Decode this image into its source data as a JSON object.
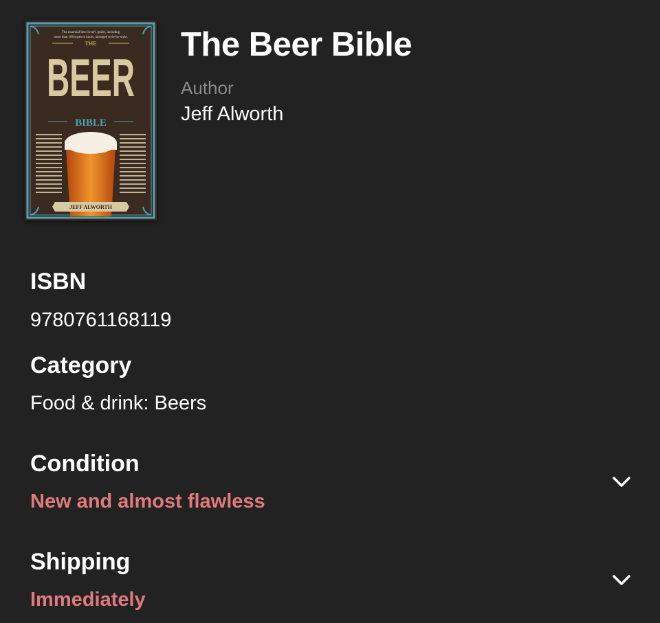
{
  "book": {
    "title": "The Beer Bible",
    "author_label": "Author",
    "author_name": "Jeff Alworth",
    "cover": {
      "tagline_line1": "The essential beer lover's guide, including",
      "tagline_line2": "more than 100 types to know, arranged style-by-style.",
      "the": "THE",
      "beer": "BEER",
      "bible": "BIBLE",
      "author": "JEFF ALWORTH",
      "background_color": "#3a2a1f",
      "border_color": "#4ba3b7",
      "title_color": "#d9c9a0"
    }
  },
  "fields": {
    "isbn": {
      "label": "ISBN",
      "value": "9780761168119"
    },
    "category": {
      "label": "Category",
      "value": "Food & drink: Beers"
    },
    "condition": {
      "label": "Condition",
      "value": "New and almost flawless",
      "icon": "chevron-down-icon"
    },
    "shipping": {
      "label": "Shipping",
      "value": "Immediately",
      "icon": "chevron-down-icon"
    }
  },
  "colors": {
    "background": "#222222",
    "text": "#ffffff",
    "muted": "#8a8a8a",
    "accent": "#e07a7d"
  }
}
